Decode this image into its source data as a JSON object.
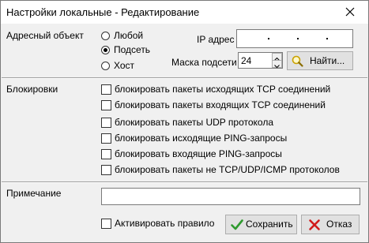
{
  "window": {
    "title": "Настройки локальные - Редактирование"
  },
  "address": {
    "label": "Адресный объект",
    "options": [
      {
        "label": "Любой",
        "selected": false
      },
      {
        "label": "Подсеть",
        "selected": true
      },
      {
        "label": "Хост",
        "selected": false
      }
    ],
    "ip_label": "IP адрес",
    "ip_value": ". . .",
    "mask_label": "Маска подсети",
    "mask_value": "24",
    "find_button": "Найти..."
  },
  "blocking": {
    "label": "Блокировки",
    "items": [
      {
        "label": "блокировать пакеты исходящих TCP соединений",
        "checked": false
      },
      {
        "label": "блокировать пакеты входящих TCP соединений",
        "checked": false
      },
      {
        "label": "блокировать пакеты UDP протокола",
        "checked": false
      },
      {
        "label": "блокировать исходящие PING-запросы",
        "checked": false
      },
      {
        "label": "блокировать входящие PING-запросы",
        "checked": false
      },
      {
        "label": "блокировать пакеты не TCP/UDP/ICMP протоколов",
        "checked": false
      }
    ]
  },
  "note": {
    "label": "Примечание",
    "value": ""
  },
  "footer": {
    "activate_label": "Активировать правило",
    "activate_checked": false,
    "save_button": "Сохранить",
    "cancel_button": "Отказ"
  },
  "colors": {
    "save_check": "#2e9a2e",
    "cancel_x": "#d11b1b",
    "magnifier": "#c9a100"
  },
  "icons": {
    "close": "close-icon",
    "find": "magnifier-icon",
    "save": "checkmark-icon",
    "cancel": "x-icon",
    "spin_up": "chevron-up-icon",
    "spin_down": "chevron-down-icon"
  }
}
